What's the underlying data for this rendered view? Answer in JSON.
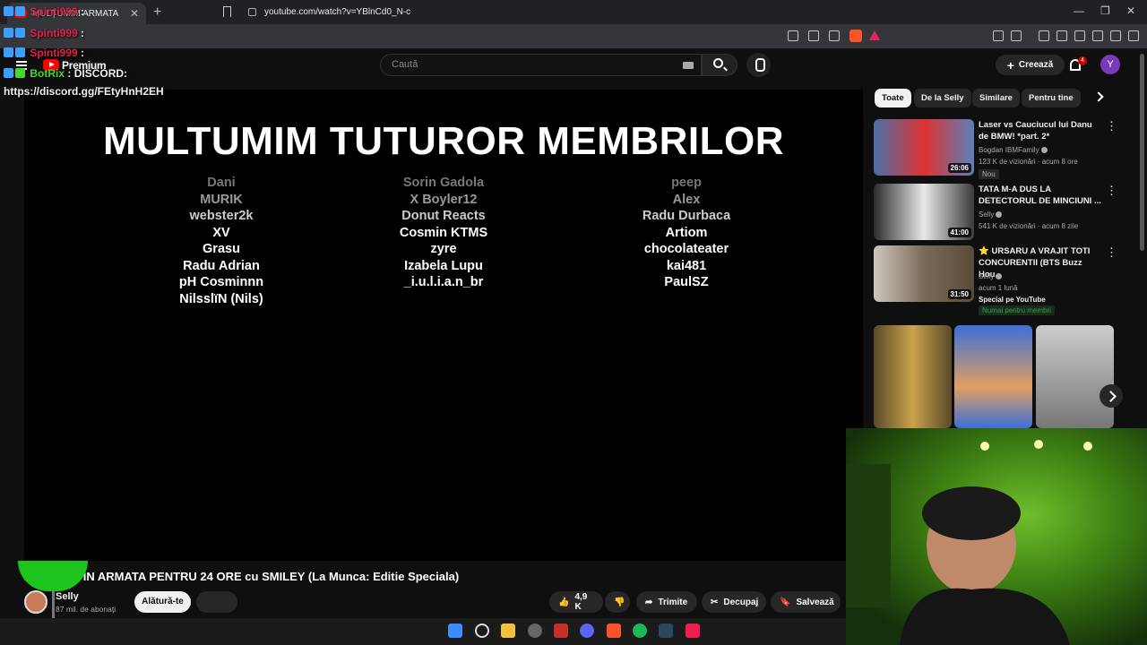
{
  "browser": {
    "tab_title": "MULȚUMIM ARMATA",
    "new_tab_symbol": "+",
    "tab_close_symbol": "✕",
    "url": "youtube.com/watch?v=YBlnCd0_N-c",
    "window_controls": [
      "—",
      "❐",
      "✕"
    ]
  },
  "overlay_chat": {
    "messages": [
      {
        "user": "Spinti999",
        "separator": ":",
        "color": "#e0234a"
      },
      {
        "user": "Spinti999",
        "separator": ":",
        "color": "#e0234a"
      },
      {
        "user": "BotRix",
        "separator": ":",
        "text": "DISCORD:",
        "color": "#43d92f"
      }
    ],
    "link": "https://discord.gg/FEtyHnH2EH"
  },
  "youtube": {
    "premium_label": "Premium",
    "search_placeholder": "Caută",
    "create_label": "Creează",
    "notification_count": "4",
    "avatar_letter": "Y"
  },
  "video": {
    "credits_heading": "MULTUMIM TUTUROR MEMBRILOR",
    "columns": [
      [
        "Dani",
        "MURIK",
        "webster2k",
        "XV",
        "Grasu",
        "Radu Adrian",
        "pH Cosminnn",
        "NilsslïN (Nils)"
      ],
      [
        "Sorin Gadola",
        "X Boyler12",
        "Donut Reacts",
        "Cosmin KTMS",
        "zyre",
        "Izabela Lupu",
        "_i.u.l.i.a.n_br"
      ],
      [
        "peep",
        "Alex",
        "Radu Durbaca",
        "Artiom",
        "chocolateater",
        "kai481",
        "PaulSZ"
      ]
    ],
    "title": "A... PILOT IN ARMATA PENTRU 24 ORE cu SMILEY (La Munca: Editie Speciala)",
    "channel_name": "Selly",
    "channel_subs": "87 mil. de abonați",
    "join_label": "Alătură-te",
    "like_count": "4,9 K",
    "share_label": "Trimite",
    "clip_label": "Decupaj",
    "save_label": "Salvează"
  },
  "sidebar": {
    "chips": [
      {
        "label": "Toate",
        "active": true
      },
      {
        "label": "De la Selly",
        "active": false
      },
      {
        "label": "Similare",
        "active": false
      },
      {
        "label": "Pentru tine",
        "active": false
      }
    ],
    "recommendations": [
      {
        "title": "Laser vs Cauciucul lui Danu de BMW! *part. 2*",
        "channel": "Bogdan IBMFamily",
        "meta": "123 K de vizionări · acum 8 ore",
        "duration": "26:06",
        "tag": "Nou"
      },
      {
        "title": "TATA M-A DUS LA DETECTORUL DE MINCIUNI ...",
        "channel": "Selly",
        "meta": "541 K de vizionări · acum 8 zile",
        "duration": "41:00"
      },
      {
        "title": "⭐ URSARU A VRAJIT TOTI CONCURENTII (BTS Buzz Hou...",
        "channel": "Selly",
        "meta": "acum 1 lună",
        "extra": "Special pe YouTube",
        "duration": "31:50",
        "members_tag": "Numai pentru membri"
      }
    ]
  },
  "colors": {
    "yt_red": "#ff0000",
    "background": "#0f0f0f",
    "webcam_green": "#4caf1f"
  }
}
